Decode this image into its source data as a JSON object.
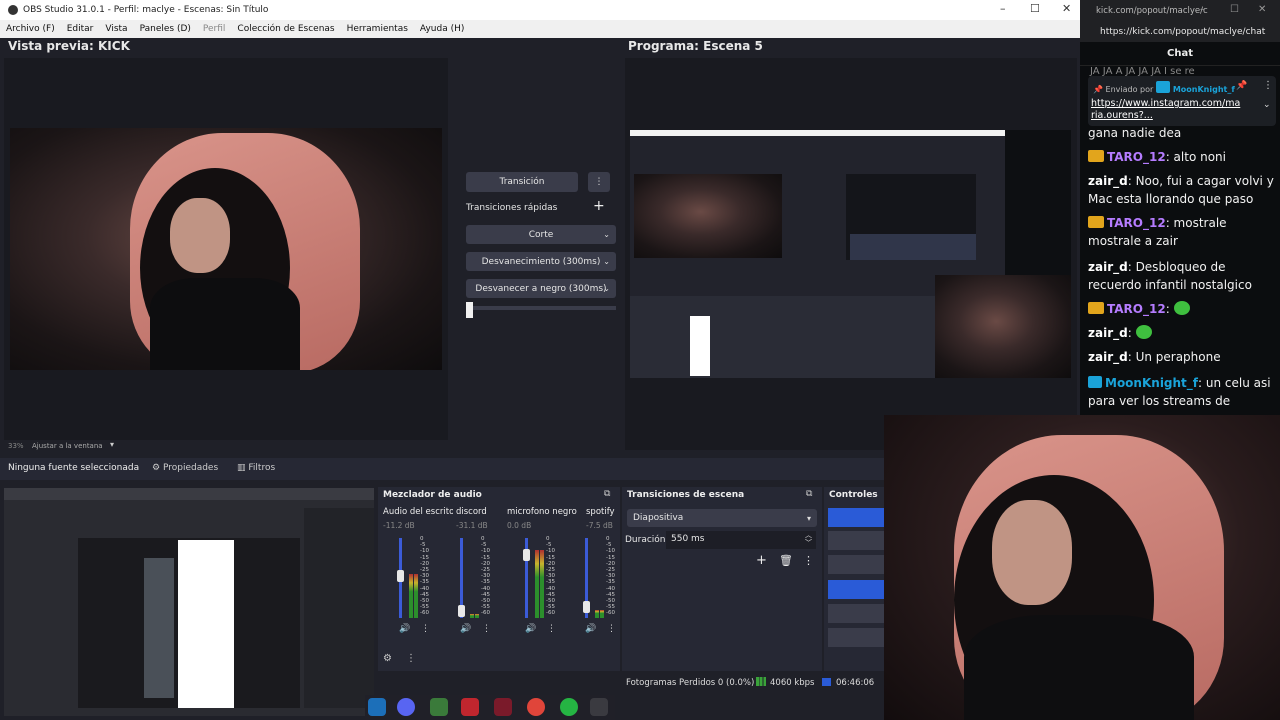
{
  "obs": {
    "title": "OBS Studio 31.0.1 - Perfil: maclye - Escenas: Sin Título",
    "menu": {
      "archivo": "Archivo (F)",
      "editar": "Editar",
      "vista": "Vista",
      "paneles": "Paneles (D)",
      "perfil": "Perfil",
      "coleccion": "Colección de Escenas",
      "herramientas": "Herramientas",
      "ayuda": "Ayuda (H)"
    },
    "preview_title": "Vista previa: KICK",
    "program_title": "Programa: Escena 5",
    "preview_zoom": "33%",
    "preview_fit": "Ajustar a la ventana",
    "transition_button": "Transición",
    "quick_transitions_label": "Transiciones rápidas",
    "quick_transitions": [
      "Corte",
      "Desvanecimiento (300ms)",
      "Desvanecer a negro (300ms)"
    ],
    "source_bar": {
      "no_source": "Ninguna fuente seleccionada",
      "properties": "Propiedades",
      "filters": "Filtros"
    },
    "audio_mixer": {
      "title": "Mezclador de audio",
      "channels": [
        {
          "name": "Audio del escritorio",
          "db": "-11.2 dB",
          "level": 0.55
        },
        {
          "name": "discord",
          "db": "-31.1 dB",
          "level": 0.05
        },
        {
          "name": "microfono negro",
          "db": "0.0 dB",
          "level": 0.85
        },
        {
          "name": "spotify",
          "db": "-7.5 dB",
          "level": 0.1
        }
      ],
      "ticks": [
        "0",
        "-5",
        "-10",
        "-15",
        "-20",
        "-25",
        "-30",
        "-35",
        "-40",
        "-45",
        "-50",
        "-55",
        "-60"
      ]
    },
    "scene_transitions": {
      "title": "Transiciones de escena",
      "selected": "Diapositiva",
      "duration_label": "Duración",
      "duration_value": "550 ms"
    },
    "controls": {
      "title": "Controles"
    },
    "status": {
      "dropped": "Fotogramas Perdidos 0 (0.0%)",
      "bitrate": "4060 kbps",
      "time": "06:46:06"
    }
  },
  "chat": {
    "tab_url": "kick.com/popout/maclye/c",
    "url": "https://kick.com/popout/maclye/chat",
    "header": "Chat",
    "top_partial": "JA JA A JA JA JA I se re",
    "pinned": {
      "sent_by_label": "Enviado por",
      "sender": "MoonKnight_f",
      "link": "https://www.instagram.com/maria.ourens?..."
    },
    "messages": [
      {
        "user": "",
        "text": "gana nadie dea",
        "color": "#f2f2f2"
      },
      {
        "user": "TARO_12",
        "text": "alto noni",
        "color": "#b57cff",
        "badge": "gold"
      },
      {
        "user": "zair_d",
        "text": "Noo, fui a cagar volvi y Mac esta llorando que paso",
        "color": "#ffffff"
      },
      {
        "user": "TARO_12",
        "text": "mostrale mostrale a zair",
        "color": "#b57cff",
        "badge": "gold"
      },
      {
        "user": "zair_d",
        "text": "Desbloqueo de recuerdo infantil nostalgico",
        "color": "#ffffff"
      },
      {
        "user": "TARO_12",
        "text": "",
        "color": "#b57cff",
        "badge": "gold",
        "emote": "green"
      },
      {
        "user": "zair_d",
        "text": "",
        "color": "#ffffff",
        "emote": "green"
      },
      {
        "user": "zair_d",
        "text": "Un peraphone",
        "color": "#ffffff"
      },
      {
        "user": "MoonKnight_f",
        "text": "un celu asi para ver los streams de",
        "color": "#1aa3d9",
        "badge": "blue"
      }
    ]
  },
  "colors": {
    "obs_bg": "#1f2028",
    "blue_button": "#2a5bd7",
    "taro": "#b57cff",
    "moon": "#1aa3d9",
    "chat_bg": "#0b0d0f"
  }
}
